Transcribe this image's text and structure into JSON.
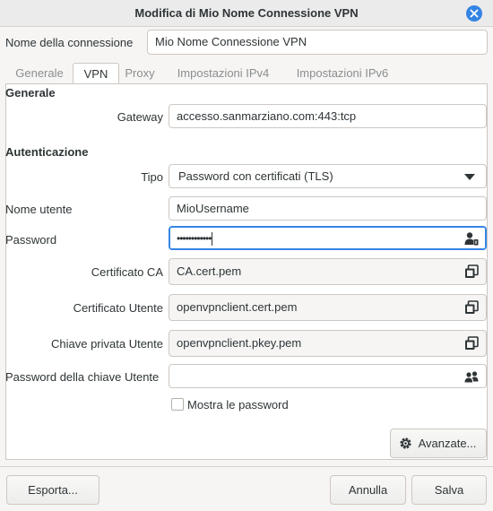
{
  "window": {
    "title": "Modifica di Mio Nome Connessione VPN",
    "close_icon": "close-icon"
  },
  "connection": {
    "name_label": "Nome della connessione",
    "name_value": "Mio Nome Connessione VPN"
  },
  "tabs": [
    {
      "label": "Generale",
      "active": false
    },
    {
      "label": "VPN",
      "active": true
    },
    {
      "label": "Proxy",
      "active": false
    },
    {
      "label": "Impostazioni IPv4",
      "active": false
    },
    {
      "label": "Impostazioni IPv6",
      "active": false
    }
  ],
  "general": {
    "heading": "Generale",
    "gateway_label": "Gateway",
    "gateway_value": "accesso.sanmarziano.com:443:tcp"
  },
  "auth": {
    "heading": "Autenticazione",
    "type_label": "Tipo",
    "type_value": "Password con certificati (TLS)",
    "username_label": "Nome utente",
    "username_value": "MioUsername",
    "password_label": "Password",
    "password_value": "••••••••••••",
    "password_icon": "user-key-icon",
    "ca_label": "Certificato CA",
    "ca_value": "CA.cert.pem",
    "user_cert_label": "Certificato Utente",
    "user_cert_value": "openvpnclient.cert.pem",
    "user_key_label": "Chiave privata Utente",
    "user_key_value": "openvpnclient.pkey.pem",
    "file_icon": "copy-file-icon",
    "key_password_label": "Password della chiave Utente",
    "key_password_value": "",
    "key_password_icon": "users-icon",
    "show_passwords_label": "Mostra le password",
    "show_passwords_checked": false
  },
  "buttons": {
    "advanced": "Avanzate...",
    "export": "Esporta...",
    "cancel": "Annulla",
    "save": "Salva"
  },
  "colors": {
    "accent": "#3584e4",
    "window_bg": "#f6f5f4",
    "panel_bg": "#ffffff"
  }
}
